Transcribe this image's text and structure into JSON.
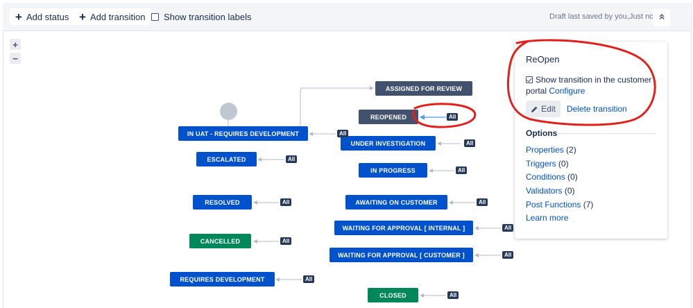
{
  "toolbar": {
    "add_status": "Add status",
    "add_transition": "Add transition",
    "show_labels": "Show transition labels",
    "draft_status": "Draft last saved by you,Just now",
    "collapse_icon": "chevron-double-up"
  },
  "zoom": {
    "in": "+",
    "out": "−"
  },
  "nodes": {
    "assigned_for_review": "ASSIGNED FOR REVIEW",
    "reopened": "REOPENED",
    "in_uat": "IN UAT - REQUIRES DEVELOPMENT",
    "under_investigation": "UNDER INVESTIGATION",
    "escalated": "ESCALATED",
    "in_progress": "IN PROGRESS",
    "resolved": "RESOLVED",
    "awaiting_on_customer": "AWAITING ON CUSTOMER",
    "waiting_internal": "WAITING FOR APPROVAL [ INTERNAL ]",
    "cancelled": "CANCELLED",
    "waiting_customer": "WAITING FOR APPROVAL [ CUSTOMER ]",
    "requires_development": "REQUIRES DEVELOPMENT",
    "closed": "CLOSED"
  },
  "all_label": "All",
  "status_colors": {
    "todo": "#42526e",
    "in_progress": "#0052cc",
    "done": "#00875a"
  },
  "panel": {
    "title": "ReOpen",
    "show_in_portal_text": "Show transition in the customer portal",
    "configure_link": "Configure",
    "edit_label": "Edit",
    "delete_label": "Delete transition",
    "options_heading": "Options",
    "options": [
      {
        "label": "Properties",
        "count": "(2)"
      },
      {
        "label": "Triggers",
        "count": "(0)"
      },
      {
        "label": "Conditions",
        "count": "(0)"
      },
      {
        "label": "Validators",
        "count": "(0)"
      },
      {
        "label": "Post Functions",
        "count": "(7)"
      }
    ],
    "learn_more": "Learn more"
  }
}
